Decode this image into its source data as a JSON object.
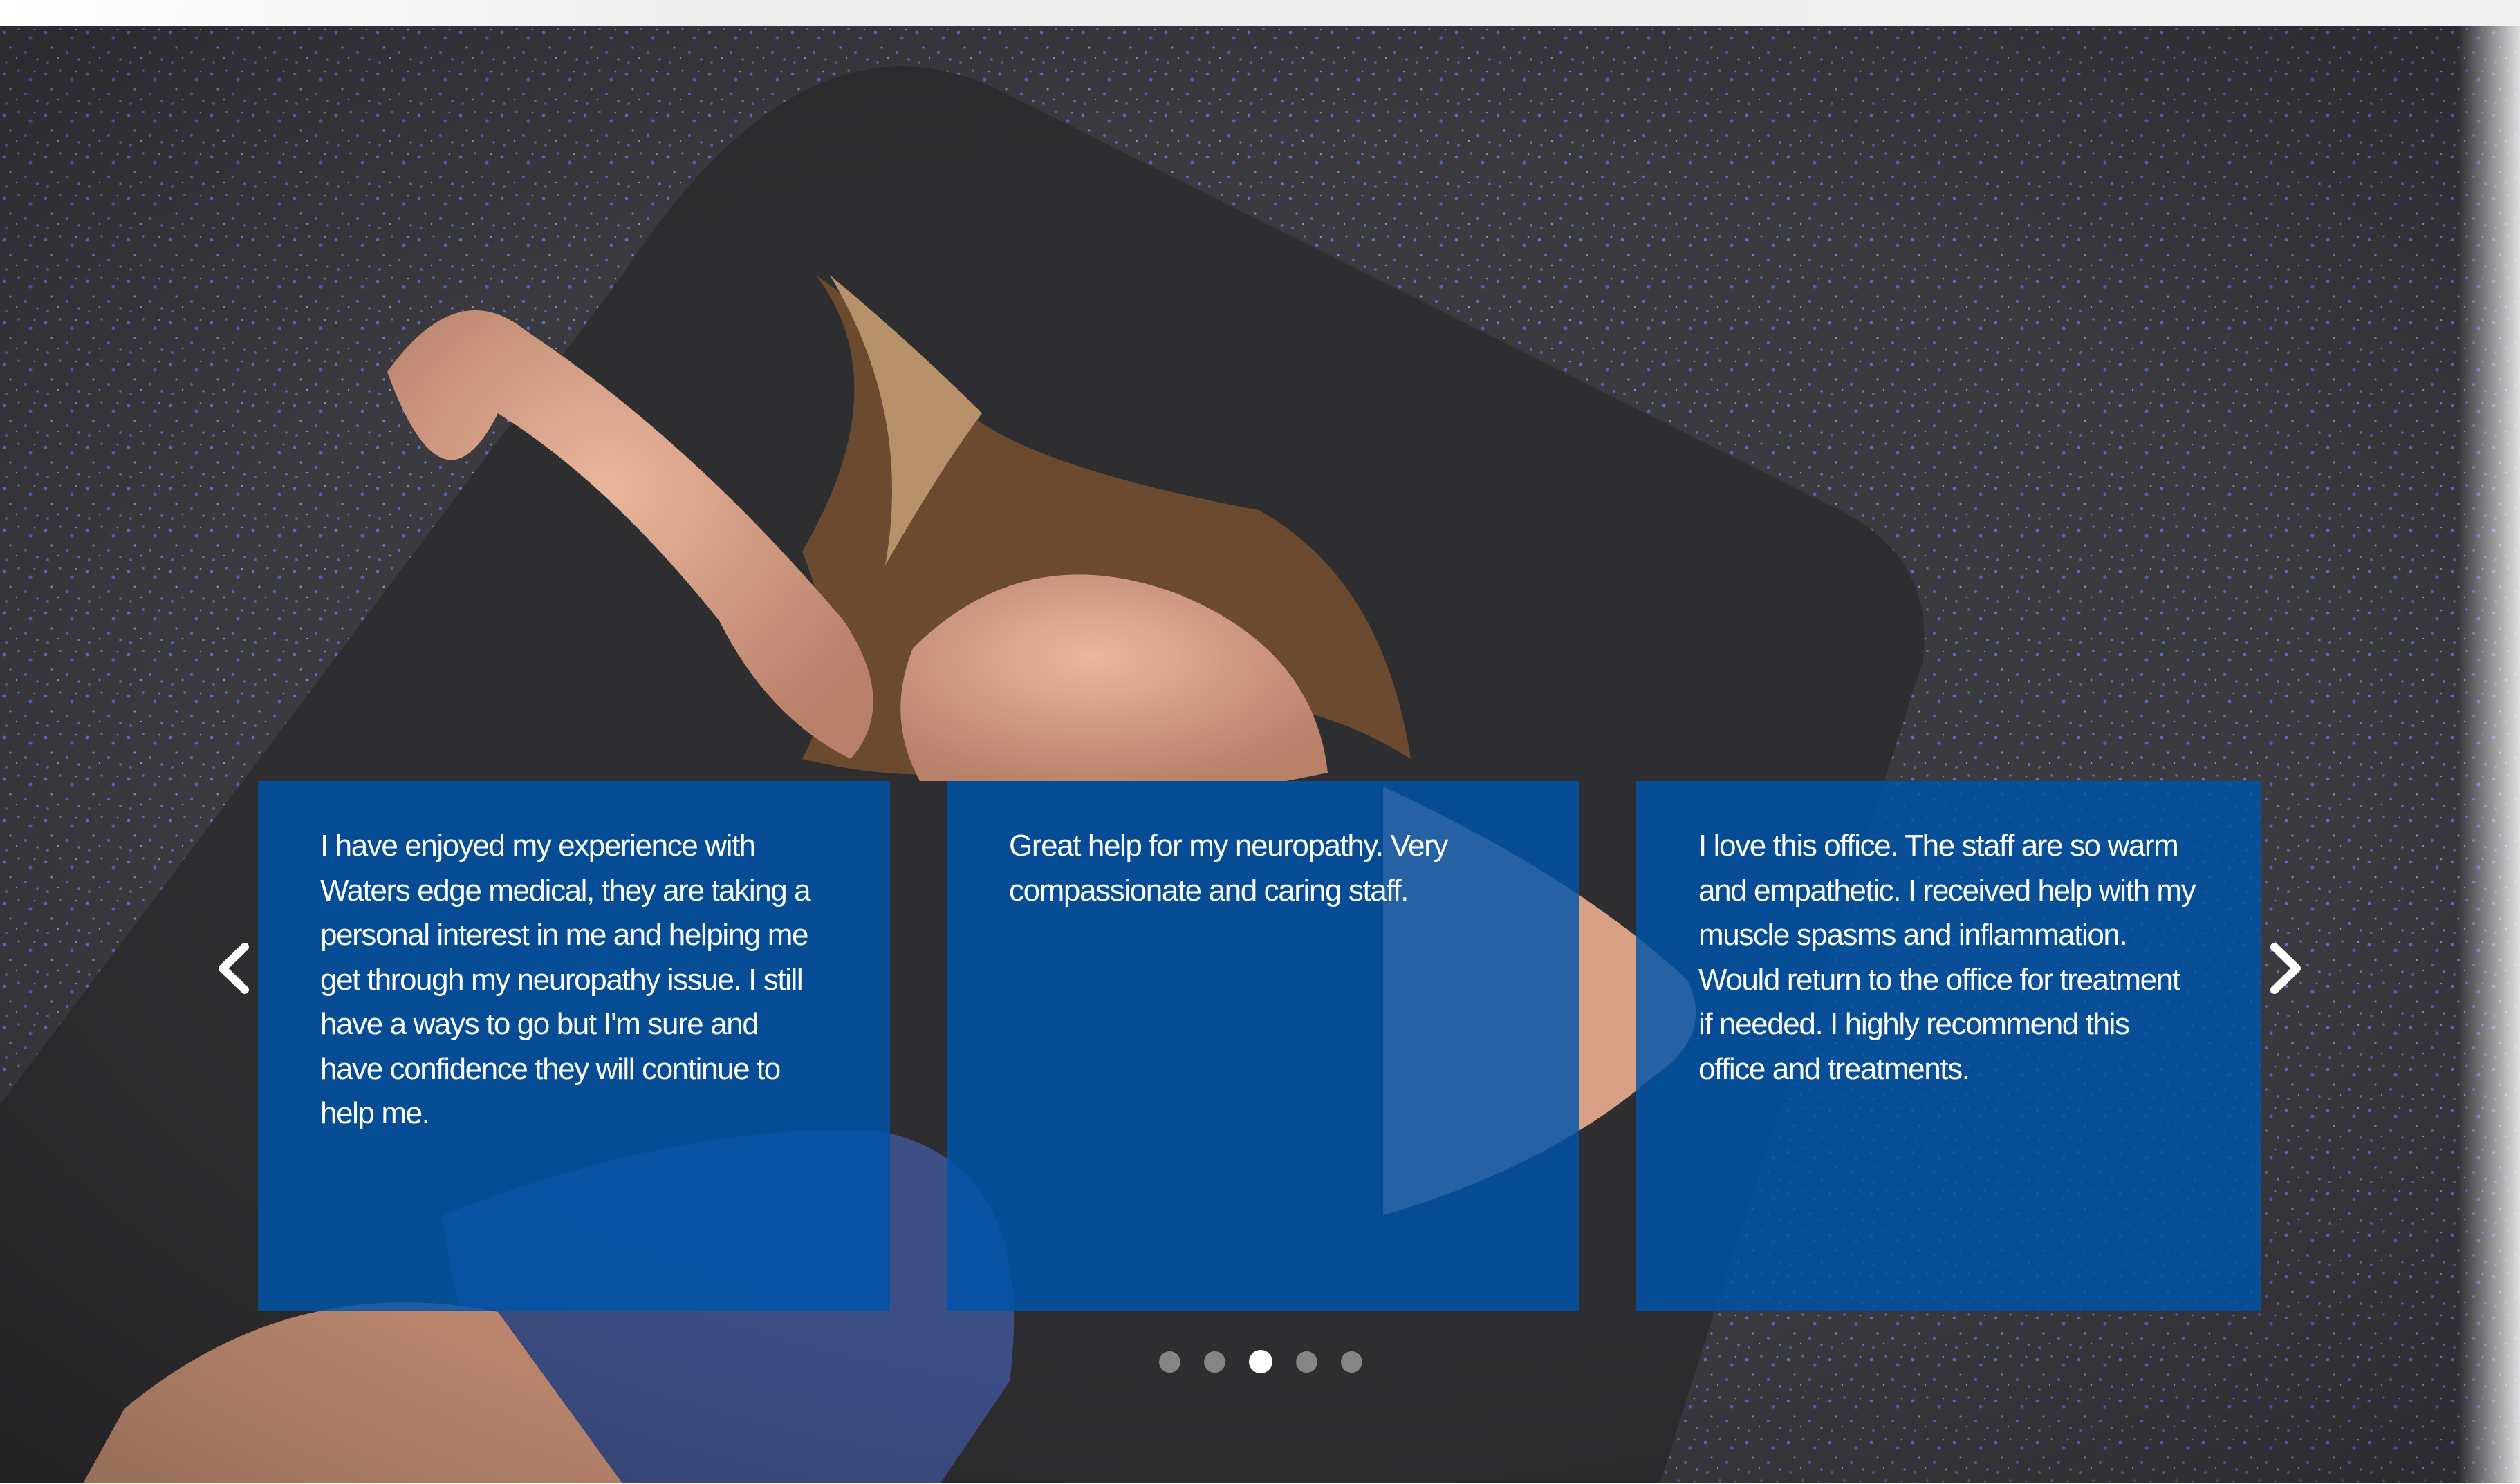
{
  "hero": {
    "image": "woman-lying-on-exercise-mat"
  },
  "carousel": {
    "prev_icon": "chevron-left-icon",
    "next_icon": "chevron-right-icon",
    "testimonials": [
      {
        "text": "I have enjoyed my experience with Waters edge medical, they are taking a personal interest in me and helping me get through my neuropathy issue. I still have a ways to go but I'm sure and have confidence they will continue to help me."
      },
      {
        "text": "Great help for my neuropathy. Very compassionate and caring staff."
      },
      {
        "text": "I love this office. The staff are so warm and empathetic. I received help with my muscle spasms and inflammation. Would return to the office for treatment if needed. I highly recommend this office and treatments."
      }
    ],
    "dots_count": 5,
    "active_dot": 3
  },
  "colors": {
    "card_background": "#0054A9",
    "dot_active": "#FFFFFF",
    "dot_inactive": "#A9A9AD"
  }
}
